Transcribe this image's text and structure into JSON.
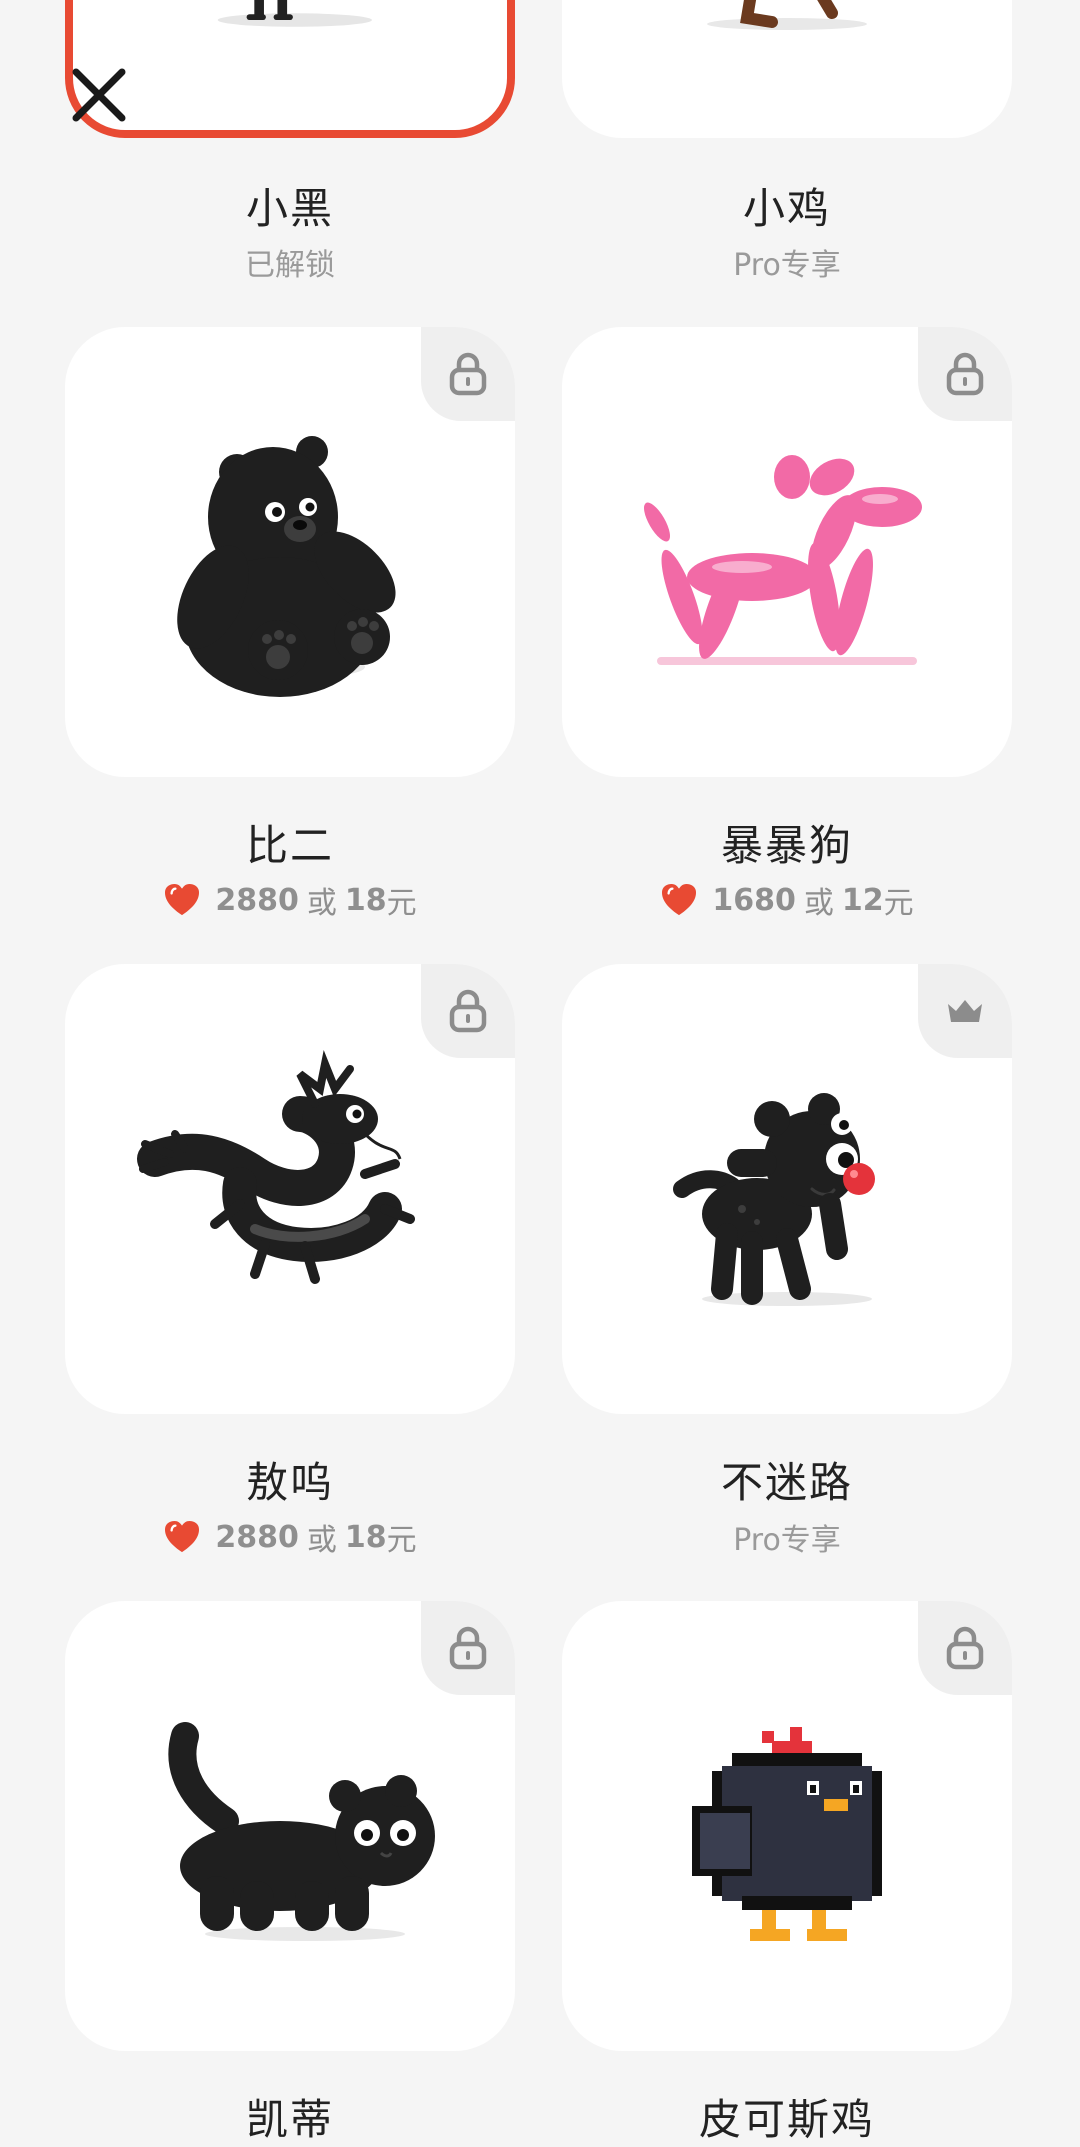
{
  "colors": {
    "accent": "#e84a33",
    "background": "#f5f5f5",
    "card": "#ffffff",
    "muted": "#9a9a9a"
  },
  "items": [
    {
      "name": "小黑",
      "status": "已解锁",
      "badge": "none",
      "selected": true
    },
    {
      "name": "小鸡",
      "status": "Pro专享",
      "badge": "none",
      "selected": false
    },
    {
      "name": "比二",
      "badge": "lock-icon",
      "price_points": "2880",
      "or_label": "或",
      "price_money": "18",
      "currency": "元"
    },
    {
      "name": "暴暴狗",
      "badge": "lock-icon",
      "price_points": "1680",
      "or_label": "或",
      "price_money": "12",
      "currency": "元"
    },
    {
      "name": "敖呜",
      "badge": "lock-icon",
      "price_points": "2880",
      "or_label": "或",
      "price_money": "18",
      "currency": "元"
    },
    {
      "name": "不迷路",
      "badge": "crown-icon",
      "status": "Pro专享"
    },
    {
      "name": "凯蒂",
      "badge": "lock-icon"
    },
    {
      "name": "皮可斯鸡",
      "badge": "lock-icon"
    }
  ]
}
